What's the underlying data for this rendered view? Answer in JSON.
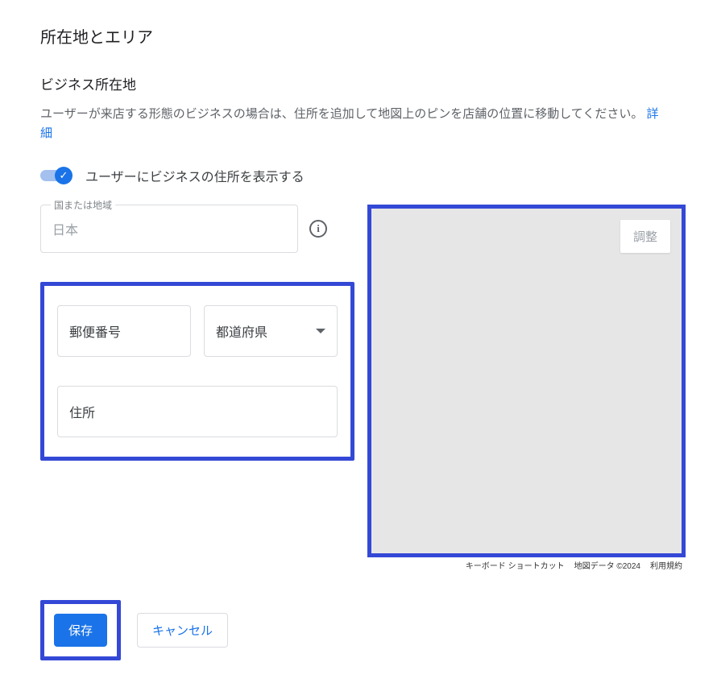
{
  "page": {
    "title": "所在地とエリア"
  },
  "section": {
    "title": "ビジネス所在地",
    "description_prefix": "ユーザーが来店する形態のビジネスの場合は、住所を追加して地図上のピンを店舗の位置に移動してください。 ",
    "details_link": "詳細"
  },
  "toggle": {
    "label": "ユーザーにビジネスの住所を表示する",
    "checked": true
  },
  "country": {
    "floating_label": "国または地域",
    "value": "日本"
  },
  "postal": {
    "placeholder": "郵便番号"
  },
  "prefecture": {
    "placeholder": "都道府県"
  },
  "address": {
    "placeholder": "住所"
  },
  "map": {
    "adjust_label": "調整",
    "footer": {
      "shortcuts": "キーボード ショートカット",
      "data": "地図データ ©2024",
      "terms": "利用規約"
    }
  },
  "actions": {
    "save": "保存",
    "cancel": "キャンセル"
  }
}
